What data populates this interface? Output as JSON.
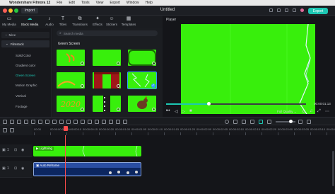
{
  "menubar": {
    "app": "Wondershare Filmora 12",
    "items": [
      "File",
      "Edit",
      "Tools",
      "View",
      "Export",
      "Window",
      "Help"
    ]
  },
  "titlebar": {
    "import_label": "Import",
    "title": "Untitled",
    "export_label": "Export"
  },
  "media_tabs": [
    {
      "label": "My Media",
      "icon": "folder-icon"
    },
    {
      "label": "Stock Media",
      "icon": "cloud-icon"
    },
    {
      "label": "Audio",
      "icon": "music-icon"
    },
    {
      "label": "Titles",
      "icon": "text-icon"
    },
    {
      "label": "Transitions",
      "icon": "transition-icon"
    },
    {
      "label": "Effects",
      "icon": "effects-icon"
    },
    {
      "label": "Stickers",
      "icon": "sticker-icon"
    },
    {
      "label": "Templates",
      "icon": "template-icon"
    }
  ],
  "sidebar": {
    "mine": "Mine",
    "filmstock": "Filmstock",
    "items": [
      "Solid Color",
      "Gradient color",
      "Green Screen",
      "Motion Graphic",
      "Vertical",
      "Footage"
    ],
    "active_index": 2
  },
  "search": {
    "placeholder": "Search media"
  },
  "grid": {
    "title": "Green Screen"
  },
  "player": {
    "label": "Player",
    "timecode": "00:00:01:13",
    "quality": "Full Quality"
  },
  "ruler": {
    "ticks": [
      "00:00",
      "00:00:00:05",
      "00:00:00:10",
      "00:00:00:15",
      "00:00:00:20",
      "00:00:01:00",
      "00:00:01:05",
      "00:00:01:10",
      "00:00:01:15",
      "00:00:01:20",
      "00:00:02:00",
      "00:00:02:05",
      "00:00:02:10",
      "00:00:02:15",
      "00:00:02:20",
      "00:00:03:00",
      "00:00:03:05",
      "00:00:03:10",
      "00:00:03:15"
    ]
  },
  "tracks": {
    "clip1": "Lightning",
    "clip2": "Auto Reframe",
    "track1_index": "1",
    "track2_index": "1"
  },
  "colors": {
    "accent": "#1dc7b3",
    "green_screen": "#38ef0c",
    "playhead": "#ff4c4c",
    "selection": "#2f9bff"
  }
}
